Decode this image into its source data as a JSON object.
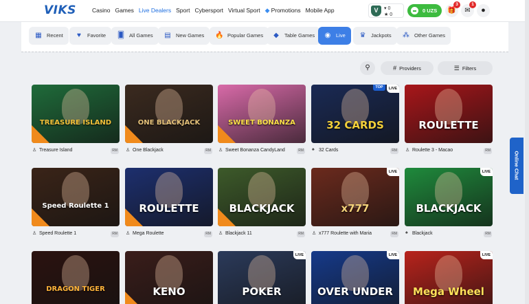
{
  "header": {
    "logo": "VIKS",
    "nav": [
      "Casino",
      "Games",
      "Live Dealers",
      "Sport",
      "Cybersport",
      "Virtual Sport",
      "Promotions",
      "Mobile App"
    ],
    "nav_active": "Live Dealers",
    "wallet_line1": "0",
    "wallet_line2": "0",
    "balance": "0 UZS",
    "gift_badge": "3",
    "mail_badge": "1"
  },
  "categories": [
    "Recent",
    "Favorite",
    "All Games",
    "New Games",
    "Popular Games",
    "Table Games",
    "Live",
    "Jackpots",
    "Other Games"
  ],
  "category_active": "Live",
  "filters": {
    "providers": "Providers",
    "filters": "Filters"
  },
  "games": [
    {
      "name": "Treasure Island",
      "thumb_title": "TREASURE ISLAND",
      "bg": "#1f6b3a",
      "fg": "#f2c23a"
    },
    {
      "name": "One Blackjack",
      "thumb_title": "ONE BLACKJACK",
      "bg": "#3b2a1f",
      "fg": "#e6c27a"
    },
    {
      "name": "Sweet Bonanza CandyLand",
      "thumb_title": "SWEET BONANZA",
      "bg": "#d86aa8",
      "fg": "#ffe14a"
    },
    {
      "name": "32 Cards",
      "thumb_title": "32 CARDS",
      "bg": "#1a2a55",
      "fg": "#f3d03a"
    },
    {
      "name": "Roulette 3 - Macao",
      "thumb_title": "ROULETTE",
      "bg": "#a8161a",
      "fg": "#ffffff"
    },
    {
      "name": "Speed Roulette 1",
      "thumb_title": "Speed Roulette 1",
      "bg": "#3a2418",
      "fg": "#ffffff"
    },
    {
      "name": "Mega Roulette",
      "thumb_title": "ROULETTE",
      "bg": "#1d2f6e",
      "fg": "#ffffff"
    },
    {
      "name": "Blackjack 11",
      "thumb_title": "BLACKJACK",
      "bg": "#3d5a2a",
      "fg": "#ffffff"
    },
    {
      "name": "x777 Roulette with Maria",
      "thumb_title": "x777",
      "bg": "#6b2a1d",
      "fg": "#f4d27a"
    },
    {
      "name": "Blackjack",
      "thumb_title": "BLACKJACK",
      "bg": "#1f8a3c",
      "fg": "#ffffff"
    },
    {
      "name": "",
      "thumb_title": "DRAGON TIGER",
      "bg": "#2b1210",
      "fg": "#ffb43a"
    },
    {
      "name": "",
      "thumb_title": "KENO",
      "bg": "#3a1d1a",
      "fg": "#ffffff"
    },
    {
      "name": "",
      "thumb_title": "POKER",
      "bg": "#2b3a5a",
      "fg": "#ffffff"
    },
    {
      "name": "",
      "thumb_title": "OVER UNDER",
      "bg": "#163a8a",
      "fg": "#ffffff"
    },
    {
      "name": "",
      "thumb_title": "Mega Wheel",
      "bg": "#b8231c",
      "fg": "#ffe05a"
    }
  ],
  "badges": {
    "live": "LIVE",
    "top": "TOP",
    "rm": "RM"
  },
  "online_chat": "Online Chat"
}
